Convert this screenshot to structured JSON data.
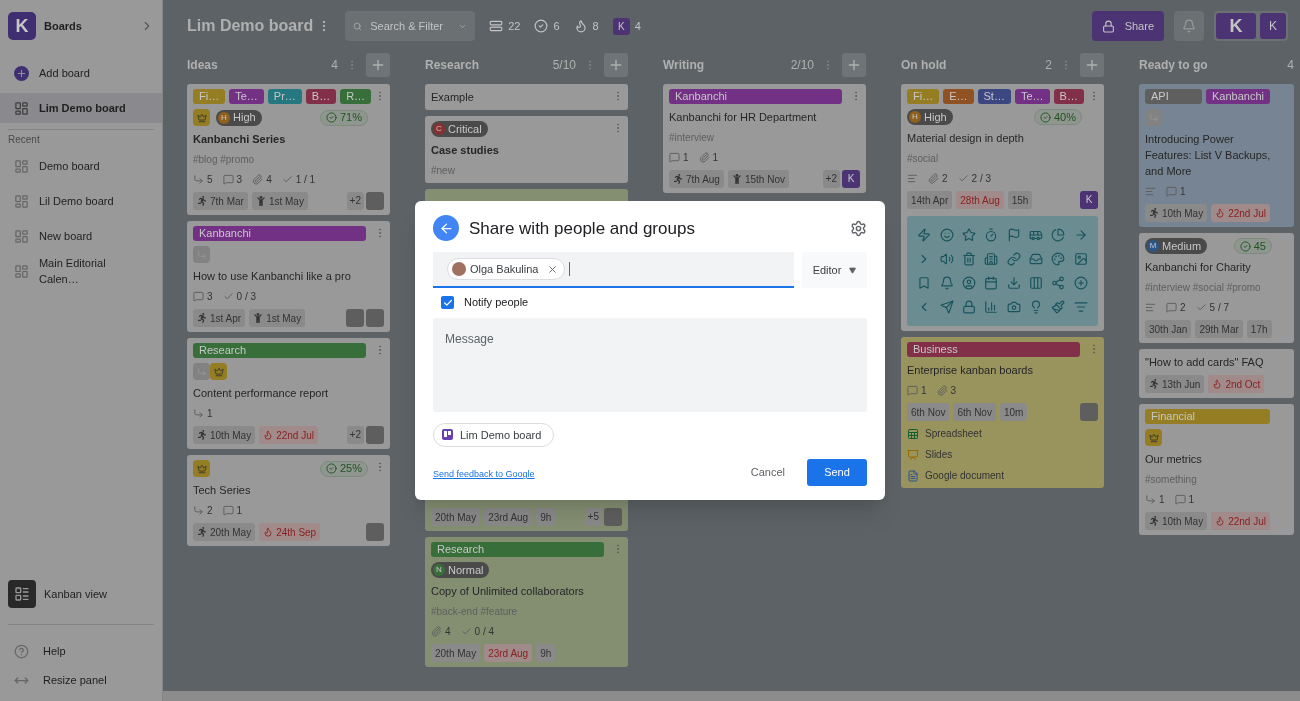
{
  "sidebar": {
    "logo": "K",
    "title": "Boards",
    "items": [
      {
        "kind": "add",
        "label": "Add board",
        "selected": false
      },
      {
        "kind": "board",
        "label": "Lim Demo board",
        "selected": true
      }
    ],
    "recent_label": "Recent",
    "recent": [
      {
        "label": "Demo board",
        "selected": false
      },
      {
        "label": "Lil Demo board",
        "selected": false
      },
      {
        "label": "New board",
        "selected": false
      },
      {
        "label": "Main Editorial Calen…",
        "selected": false
      }
    ],
    "view": {
      "label": "Kanban view",
      "selected": true
    },
    "help": "Help",
    "resize": "Resize panel"
  },
  "topbar": {
    "board_title": "Lim Demo board",
    "search": {
      "placeholder": "Search & Filter"
    },
    "stats": [
      {
        "kind": "cards",
        "value": "22"
      },
      {
        "kind": "done",
        "value": "6"
      },
      {
        "kind": "hot",
        "value": "8"
      },
      {
        "kind": "members",
        "letter": "K",
        "value": "4"
      }
    ],
    "share": "Share",
    "logo": "K",
    "user": "K"
  },
  "columns": [
    {
      "title": "Ideas",
      "count": "4",
      "actions": true,
      "cards": [
        {
          "kind": "plain",
          "color": "#999999",
          "menu": true,
          "labels": [
            {
              "text": "Fi…",
              "color": "#947d22"
            },
            {
              "text": "Te…",
              "color": "#733186"
            },
            {
              "text": "Pr…",
              "color": "#257780"
            },
            {
              "text": "B…",
              "color": "#823049"
            },
            {
              "text": "R…",
              "color": "#376e3a"
            }
          ],
          "badges": [
            {
              "kind": "crown"
            }
          ],
          "priority": {
            "letter": "H",
            "text": "High",
            "color": "#90601d"
          },
          "progress": "71%",
          "title": "Kanbanchi Series",
          "title_bold": true,
          "tags": "#blog #promo",
          "stats": [
            {
              "kind": "subcards",
              "value": "5"
            },
            {
              "kind": "comments",
              "value": "3"
            },
            {
              "kind": "attachments",
              "value": "4"
            },
            {
              "kind": "checklist",
              "value": "1 / 1"
            }
          ],
          "dates": [
            {
              "kind": "start",
              "text": "7th Mar",
              "overdue": false
            },
            {
              "kind": "end",
              "text": "1st May",
              "overdue": false
            }
          ],
          "extra_members": "+2",
          "members": [
            {
              "kind": "photo"
            }
          ]
        },
        {
          "kind": "plain",
          "color": "#999999",
          "menu": true,
          "labels": [
            {
              "text": "Kanbanchi",
              "color": "#733186"
            }
          ],
          "badges": [
            {
              "kind": "subcard"
            }
          ],
          "title": "How to use Kanbanchi like a pro",
          "title_bold": false,
          "stats": [
            {
              "kind": "comments",
              "value": "3"
            },
            {
              "kind": "checklist",
              "value": "0 / 3"
            }
          ],
          "dates": [
            {
              "kind": "start",
              "text": "1st Apr",
              "overdue": false
            },
            {
              "kind": "end",
              "text": "1st May",
              "overdue": false
            }
          ],
          "members": [
            {
              "kind": "photo"
            },
            {
              "kind": "photo"
            }
          ]
        },
        {
          "kind": "plain",
          "color": "#999999",
          "menu": true,
          "labels": [
            {
              "text": "Research",
              "color": "#376e3a"
            }
          ],
          "badges": [
            {
              "kind": "subcard"
            },
            {
              "kind": "crown"
            }
          ],
          "title": "Content performance report",
          "title_bold": false,
          "stats": [
            {
              "kind": "subcards",
              "value": "1"
            }
          ],
          "dates": [
            {
              "kind": "start",
              "text": "10th May",
              "overdue": false
            },
            {
              "kind": "due",
              "text": "22nd Jul",
              "overdue": true
            }
          ],
          "extra_members": "+2",
          "members": [
            {
              "kind": "photo"
            }
          ]
        },
        {
          "kind": "plain",
          "color": "#999999",
          "menu": true,
          "badges": [
            {
              "kind": "crown"
            }
          ],
          "progress": "25%",
          "title": "Tech Series",
          "title_bold": false,
          "stats": [
            {
              "kind": "subcards",
              "value": "2"
            },
            {
              "kind": "comments",
              "value": "1"
            }
          ],
          "dates": [
            {
              "kind": "start",
              "text": "20th May",
              "overdue": false
            },
            {
              "kind": "due",
              "text": "24th Sep",
              "overdue": true
            }
          ],
          "members": [
            {
              "kind": "photo"
            }
          ]
        }
      ]
    },
    {
      "title": "Research",
      "count": "5/10",
      "actions": true,
      "cards": [
        {
          "kind": "plain",
          "color": "#999999",
          "menu": true,
          "title": "Example",
          "title_bold": false
        },
        {
          "kind": "plain",
          "color": "#999999",
          "menu": true,
          "priority": {
            "letter": "C",
            "text": "Critical",
            "color": "#863030"
          },
          "title": "Case studies",
          "title_bold": true,
          "tags": "#new"
        },
        {
          "kind": "obscured",
          "color": "#848f72",
          "menu": false,
          "dates": [
            {
              "kind": "plain",
              "text": "20th May",
              "overdue": false
            },
            {
              "kind": "plain",
              "text": "23rd Aug",
              "overdue": false
            },
            {
              "kind": "plain",
              "text": "9h",
              "overdue": false
            }
          ],
          "extra_members": "+5",
          "members": [
            {
              "kind": "photo"
            }
          ]
        },
        {
          "kind": "plain",
          "color": "#848f72",
          "menu": true,
          "labels": [
            {
              "text": "Research",
              "color": "#376e3a"
            }
          ],
          "priority": {
            "letter": "N",
            "text": "Normal",
            "color": "#376e3a"
          },
          "title": "Copy of Unlimited collaborators",
          "title_bold": false,
          "tags": "#back-end #feature",
          "stats": [
            {
              "kind": "attachments",
              "value": "4"
            },
            {
              "kind": "checklist",
              "value": "0 / 4"
            }
          ],
          "dates": [
            {
              "kind": "plain",
              "text": "20th May",
              "overdue": false
            },
            {
              "kind": "plain",
              "text": "23rd Aug",
              "overdue": true
            },
            {
              "kind": "plain",
              "text": "9h",
              "overdue": false
            }
          ]
        }
      ]
    },
    {
      "title": "Writing",
      "count": "2/10",
      "actions": true,
      "cards": [
        {
          "kind": "plain",
          "color": "#999999",
          "menu": true,
          "labels": [
            {
              "text": "Kanbanchi",
              "color": "#733186"
            }
          ],
          "title": "Kanbanchi for HR Department",
          "title_bold": false,
          "tags": "#interview",
          "stats": [
            {
              "kind": "comments",
              "value": "1"
            },
            {
              "kind": "attachments",
              "value": "1"
            }
          ],
          "dates": [
            {
              "kind": "start",
              "text": "7th Aug",
              "overdue": false
            },
            {
              "kind": "end",
              "text": "15th Nov",
              "overdue": false
            }
          ],
          "extra_members": "+2",
          "members": [
            {
              "kind": "letter",
              "text": "K"
            }
          ]
        }
      ]
    },
    {
      "title": "On hold",
      "count": "2",
      "actions": true,
      "cards": [
        {
          "kind": "icon_cover",
          "color": "#999999",
          "menu": true,
          "labels": [
            {
              "text": "Fi…",
              "color": "#947d22"
            },
            {
              "text": "E…",
              "color": "#905223"
            },
            {
              "text": "St…",
              "color": "#3c4782"
            },
            {
              "text": "Te…",
              "color": "#733186"
            },
            {
              "text": "B…",
              "color": "#823049"
            }
          ],
          "priority": {
            "letter": "H",
            "text": "High",
            "color": "#90601d"
          },
          "progress": "40%",
          "title": "Material design in depth",
          "title_bold": false,
          "tags": "#social",
          "stats": [
            {
              "kind": "description"
            },
            {
              "kind": "attachments",
              "value": "2"
            },
            {
              "kind": "checklist",
              "value": "2 / 3"
            }
          ],
          "dates": [
            {
              "kind": "plain",
              "text": "14th Apr",
              "overdue": false
            },
            {
              "kind": "plain",
              "text": "28th Aug",
              "overdue": true
            },
            {
              "kind": "plain",
              "text": "15h",
              "overdue": false
            }
          ],
          "members": [
            {
              "kind": "letter",
              "text": "K"
            }
          ]
        },
        {
          "kind": "plain",
          "color": "#99935e",
          "menu": true,
          "labels": [
            {
              "text": "Business",
              "color": "#823049"
            }
          ],
          "title": "Enterprise kanban boards",
          "title_bold": false,
          "stats": [
            {
              "kind": "comments",
              "value": "1"
            },
            {
              "kind": "attachments",
              "value": "3"
            }
          ],
          "dates": [
            {
              "kind": "plain",
              "text": "6th Nov",
              "overdue": false
            },
            {
              "kind": "plain",
              "text": "6th Nov",
              "overdue": false
            },
            {
              "kind": "plain",
              "text": "10m",
              "overdue": false
            }
          ],
          "members": [
            {
              "kind": "photo"
            }
          ],
          "files": [
            {
              "kind": "sheet",
              "name": "Spreadsheet"
            },
            {
              "kind": "slides",
              "name": "Slides"
            },
            {
              "kind": "doc",
              "name": "Google document"
            }
          ]
        }
      ]
    },
    {
      "title": "Ready to go",
      "count": "4",
      "actions": false,
      "cards": [
        {
          "kind": "plain",
          "color": "#768493",
          "menu": false,
          "labels": [
            {
              "text": "API",
              "color": "#5f5f5f"
            },
            {
              "text": "Kanbanchi",
              "color": "#733186"
            }
          ],
          "badges": [
            {
              "kind": "subcard"
            }
          ],
          "title": "Introducing Power Features: List V Backups, and More",
          "title_bold": false,
          "stats": [
            {
              "kind": "description"
            },
            {
              "kind": "comments",
              "value": "1"
            }
          ],
          "dates": [
            {
              "kind": "start",
              "text": "10th May",
              "overdue": false
            },
            {
              "kind": "due",
              "text": "22nd Jul",
              "overdue": true
            }
          ]
        },
        {
          "kind": "plain",
          "color": "#999999",
          "menu": false,
          "priority": {
            "letter": "M",
            "text": "Medium",
            "color": "#2c5688"
          },
          "progress": "45",
          "title": "Kanbanchi for Charity",
          "title_bold": false,
          "tags": "#interview #social #promo",
          "stats": [
            {
              "kind": "description"
            },
            {
              "kind": "comments",
              "value": "2"
            },
            {
              "kind": "checklist",
              "value": "5 / 7"
            }
          ],
          "dates": [
            {
              "kind": "plain",
              "text": "30th Jan",
              "overdue": false
            },
            {
              "kind": "plain",
              "text": "29th Mar",
              "overdue": false
            },
            {
              "kind": "plain",
              "text": "17h",
              "overdue": false
            }
          ]
        },
        {
          "kind": "plain",
          "color": "#999999",
          "menu": false,
          "title": "\"How to add cards\" FAQ",
          "title_bold": false,
          "dates": [
            {
              "kind": "start",
              "text": "13th Jun",
              "overdue": false
            },
            {
              "kind": "due",
              "text": "2nd Oct",
              "overdue": true
            }
          ]
        },
        {
          "kind": "plain",
          "color": "#999999",
          "menu": false,
          "labels": [
            {
              "text": "Financial",
              "color": "#947d22"
            }
          ],
          "badges": [
            {
              "kind": "crown"
            }
          ],
          "title": "Our metrics",
          "title_bold": false,
          "tags": "#something",
          "stats": [
            {
              "kind": "subcards",
              "value": "1"
            },
            {
              "kind": "comments",
              "value": "1"
            }
          ],
          "dates": [
            {
              "kind": "start",
              "text": "10th May",
              "overdue": false
            },
            {
              "kind": "due",
              "text": "22nd Jul",
              "overdue": true
            }
          ]
        }
      ]
    }
  ],
  "dialog": {
    "title": "Share with people and groups",
    "recipient": "Olga Bakulina",
    "role": "Editor",
    "notify": {
      "label": "Notify people",
      "checked": true
    },
    "message": {
      "placeholder": "Message"
    },
    "item": "Lim Demo board",
    "feedback": "Send feedback to Google",
    "cancel": "Cancel",
    "send": "Send"
  }
}
